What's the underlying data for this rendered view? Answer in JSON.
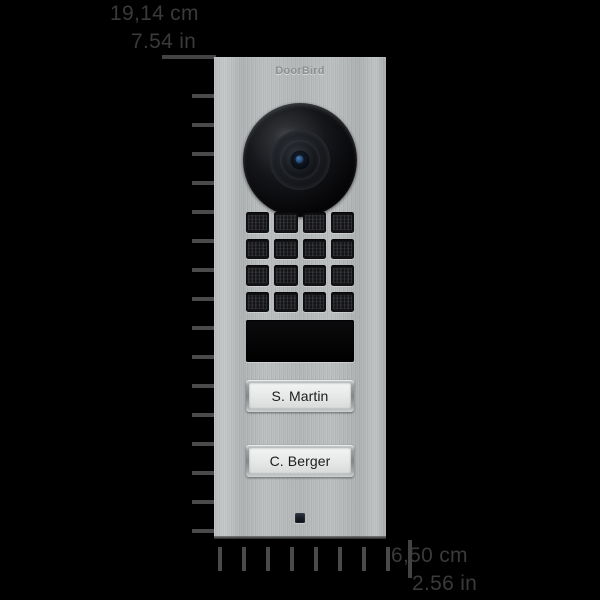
{
  "background_color": "#000000",
  "dimensions": {
    "width_cm": "19,14 cm",
    "width_in": "7.54 in",
    "height_cm": "6,50 cm",
    "height_in": "2.56 in"
  },
  "device": {
    "brand": "DoorBird",
    "material_color": "#b8bbbc",
    "camera": {
      "name": "camera-lens",
      "housing_color": "#0a0b0d",
      "highlight_color": "#3f6ba5"
    },
    "speaker_grille": {
      "rows": 4,
      "columns": 4,
      "cell_color": "#141417"
    },
    "ir_panel": {
      "color": "#060607"
    },
    "call_buttons": [
      {
        "name": "S. Martin"
      },
      {
        "name": "C. Berger"
      }
    ],
    "status_led": {
      "color": "#1a1f28"
    }
  },
  "rulers": {
    "vertical": {
      "major_ticks": 1,
      "minor_ticks": 16,
      "color": "#4a4a4a"
    },
    "horizontal": {
      "minor_ticks": 8,
      "major_ticks": 1,
      "color": "#4a4a4a"
    }
  }
}
